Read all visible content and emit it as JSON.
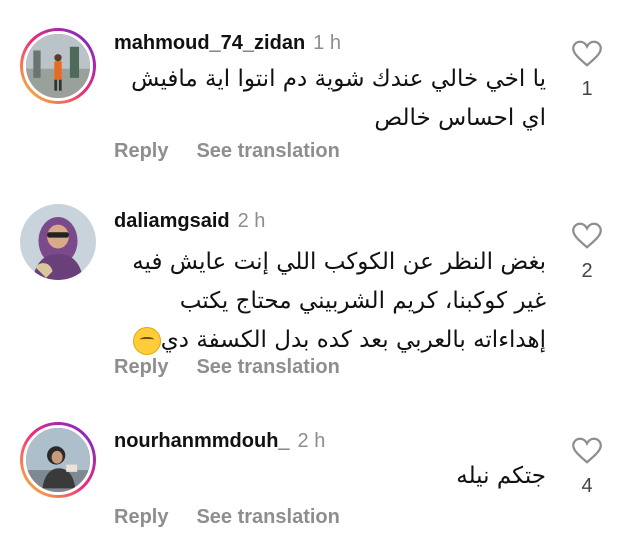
{
  "comments": [
    {
      "username": "mahmoud_74_zidan",
      "time": "1 h",
      "text": "يا اخي خالي عندك شوية دم انتوا اية مافيش اي احساس خالص",
      "likes": "1",
      "reply_label": "Reply",
      "translate_label": "See translation",
      "avatar_ring": true
    },
    {
      "username": "daliamgsaid",
      "time": "2 h",
      "text": "بغض النظر عن الكوكب اللي إنت عايش فيه غير كوكبنا، كريم الشربيني محتاج يكتب إهداءاته بالعربي بعد كده بدل الكسفة دي",
      "emoji": "smiling-face-with-tear-emoji",
      "likes": "2",
      "reply_label": "Reply",
      "translate_label": "See translation",
      "avatar_ring": false
    },
    {
      "username": "nourhanmmdouh_",
      "time": "2 h",
      "text": "جتكم نيله",
      "likes": "4",
      "reply_label": "Reply",
      "translate_label": "See translation",
      "avatar_ring": true
    }
  ],
  "colors": {
    "text": "#111111",
    "muted": "#8e8e8e",
    "story_ring_start": "#f9ce34",
    "story_ring_end": "#6228d7"
  },
  "icons": {
    "like": "heart-outline-icon"
  }
}
